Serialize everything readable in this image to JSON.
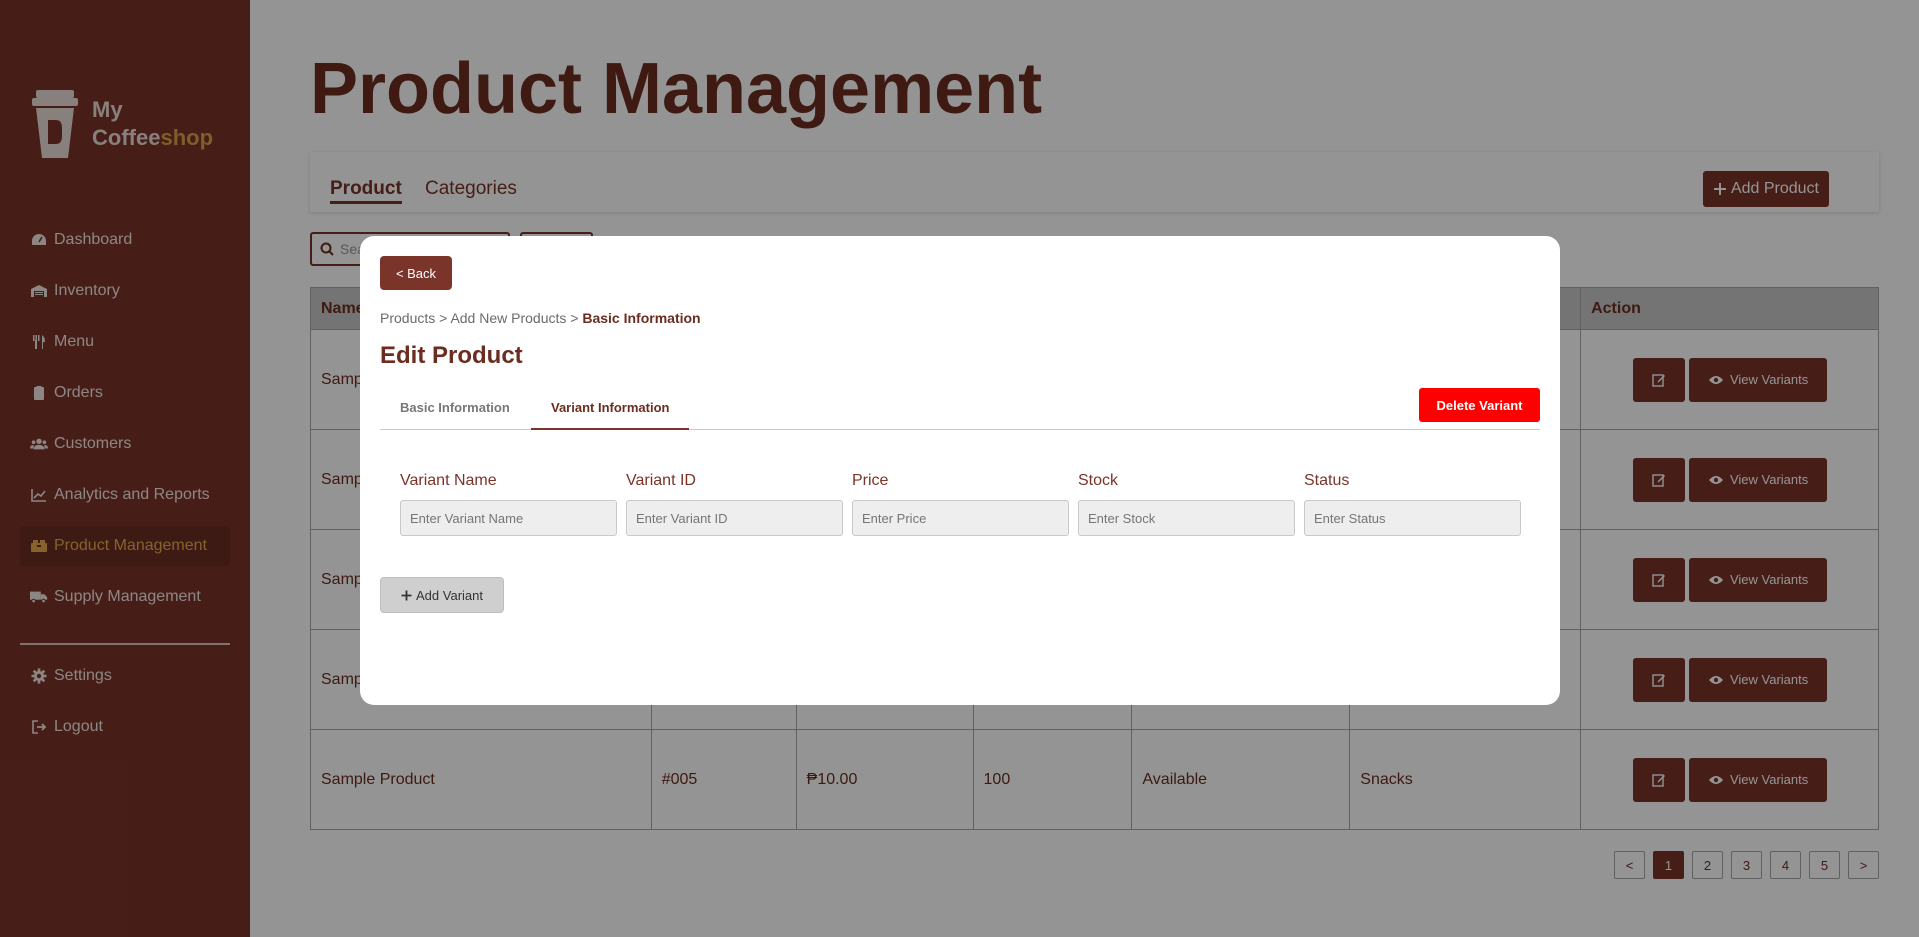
{
  "brand": {
    "line1": "My",
    "line2a": "Coffee",
    "line2b": "shop"
  },
  "sidebar": {
    "items": [
      {
        "label": "Dashboard",
        "icon": "dashboard-icon"
      },
      {
        "label": "Inventory",
        "icon": "warehouse-icon"
      },
      {
        "label": "Menu",
        "icon": "utensils-icon"
      },
      {
        "label": "Orders",
        "icon": "clipboard-icon"
      },
      {
        "label": "Customers",
        "icon": "users-icon"
      },
      {
        "label": "Analytics and Reports",
        "icon": "chart-line-icon"
      },
      {
        "label": "Product Management",
        "icon": "boxes-icon",
        "active": true
      },
      {
        "label": "Supply Management",
        "icon": "truck-icon"
      }
    ],
    "bottom": [
      {
        "label": "Settings",
        "icon": "gear-icon"
      },
      {
        "label": "Logout",
        "icon": "logout-icon"
      }
    ]
  },
  "page": {
    "title": "Product Management",
    "tabs": [
      "Product",
      "Categories"
    ],
    "add_product": "Add Product",
    "search_placeholder": "Sea",
    "table": {
      "headers": [
        "Name",
        "",
        "",
        "",
        "",
        "",
        "Action"
      ],
      "rows": [
        [
          "Samp",
          "",
          "",
          "",
          "",
          ""
        ],
        [
          "Samp",
          "",
          "",
          "",
          "",
          ""
        ],
        [
          "Samp",
          "",
          "",
          "",
          "",
          ""
        ],
        [
          "Samp",
          "",
          "",
          "",
          "",
          ""
        ],
        [
          "Sample Product",
          "#005",
          "₱10.00",
          "100",
          "Available",
          "Snacks"
        ]
      ],
      "view_variants": "View Variants"
    },
    "pagination": [
      "<",
      "1",
      "2",
      "3",
      "4",
      "5",
      ">"
    ]
  },
  "modal": {
    "back": "< Back",
    "breadcrumb": {
      "a": "Products",
      "b": "Add New Products",
      "current": "Basic Information",
      "sep": " > "
    },
    "title": "Edit Product",
    "tabs": [
      "Basic Information",
      "Variant Information"
    ],
    "delete": "Delete Variant",
    "fields": [
      {
        "label": "Variant Name",
        "placeholder": "Enter Variant Name"
      },
      {
        "label": "Variant ID",
        "placeholder": "Enter Variant ID"
      },
      {
        "label": "Price",
        "placeholder": "Enter Price"
      },
      {
        "label": "Stock",
        "placeholder": "Enter Stock"
      },
      {
        "label": "Status",
        "placeholder": "Enter Status"
      }
    ],
    "add_variant": "Add Variant"
  },
  "colors": {
    "primary": "#7a3429",
    "accent": "#d9a24a",
    "danger": "#ff0000"
  }
}
